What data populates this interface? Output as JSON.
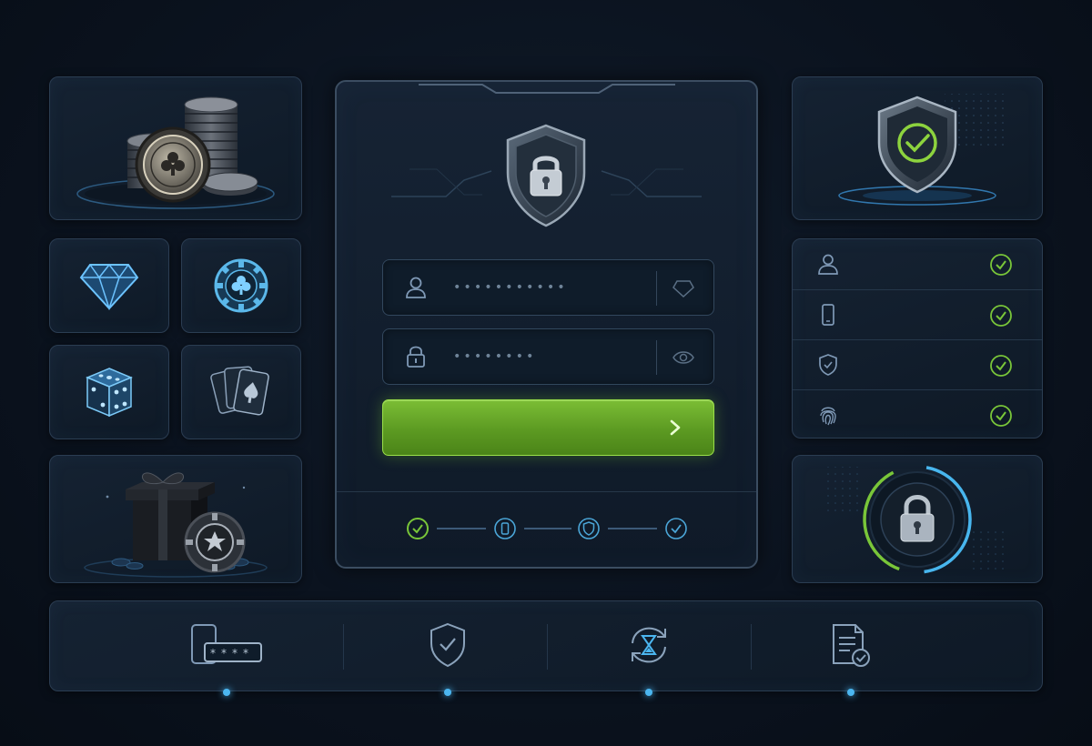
{
  "theme": {
    "background": "#0b131f",
    "panel": "#132030",
    "border": "#2b3d52",
    "accent_green": "#79c639",
    "accent_blue": "#4bb6f0",
    "icon_color": "#7f99b6"
  },
  "left_tiles": [
    {
      "icon": "poker-chip-stack-icon"
    },
    {
      "icon": "diamond-icon"
    },
    {
      "icon": "poker-chip-club-icon"
    },
    {
      "icon": "dice-icon"
    },
    {
      "icon": "playing-cards-icon"
    },
    {
      "icon": "gift-box-chip-icon"
    }
  ],
  "login": {
    "header_icon": "shield-lock-icon",
    "username": {
      "icon": "user-icon",
      "value": "•••••••••••",
      "trailing_icon": "diamond-outline-icon"
    },
    "password": {
      "icon": "lock-icon",
      "value": "••••••••",
      "trailing_icon": "eye-icon"
    },
    "submit": {
      "icon": "chevron-right-icon",
      "label": ""
    },
    "progress_steps": [
      {
        "icon": "check-circle-icon",
        "state": "done",
        "color": "#79c639"
      },
      {
        "icon": "phone-icon",
        "state": "pending",
        "color": "#4ba6d8"
      },
      {
        "icon": "shield-icon",
        "state": "pending",
        "color": "#4ba6d8"
      },
      {
        "icon": "check-circle-icon",
        "state": "pending",
        "color": "#4ba6d8"
      }
    ]
  },
  "right_panels": {
    "shield_check": {
      "icon": "shield-check-icon"
    },
    "security_items": [
      {
        "icon": "user-icon",
        "status": "verified"
      },
      {
        "icon": "phone-icon",
        "status": "verified"
      },
      {
        "icon": "shield-icon",
        "status": "verified"
      },
      {
        "icon": "fingerprint-icon",
        "status": "verified"
      }
    ],
    "lock_progress": {
      "icon": "padlock-icon",
      "progress_fraction": 0.82
    }
  },
  "bottom_bar": [
    {
      "icon": "phone-pin-icon"
    },
    {
      "icon": "shield-check-icon"
    },
    {
      "icon": "hourglass-refresh-icon"
    },
    {
      "icon": "document-check-icon"
    }
  ]
}
